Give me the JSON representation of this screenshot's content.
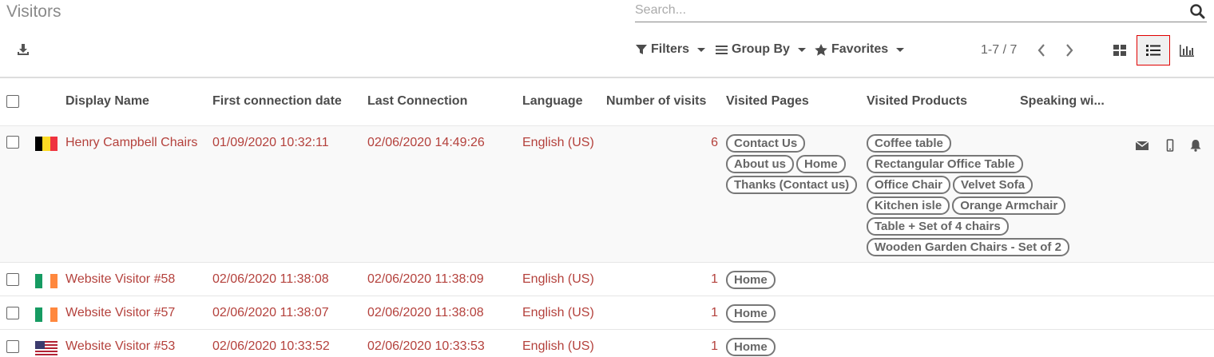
{
  "page": {
    "title": "Visitors"
  },
  "search": {
    "placeholder": "Search..."
  },
  "toolbar": {
    "filters": "Filters",
    "group_by": "Group By",
    "favorites": "Favorites",
    "pager": "1-7 / 7"
  },
  "columns": {
    "display_name": "Display Name",
    "first_connection": "First connection date",
    "last_connection": "Last Connection",
    "language": "Language",
    "visits": "Number of visits",
    "pages": "Visited Pages",
    "products": "Visited Products",
    "speaking": "Speaking wi..."
  },
  "rows": [
    {
      "name": "Henry Campbell Chairs",
      "flag": "belgium",
      "flag_colors": [
        "#000000",
        "#fdda24",
        "#ef3340"
      ],
      "first": "01/09/2020 10:32:11",
      "last": "02/06/2020 14:49:26",
      "language": "English (US)",
      "visits": "6",
      "pages": [
        "Contact Us",
        "About us",
        "Home",
        "Thanks (Contact us)"
      ],
      "products": [
        "Coffee table",
        "Rectangular Office Table",
        "Office Chair",
        "Velvet Sofa",
        "Kitchen isle",
        "Orange Armchair",
        "Table + Set of 4 chairs",
        "Wooden Garden Chairs - Set of 2"
      ]
    },
    {
      "name": "Website Visitor #58",
      "flag": "ireland",
      "flag_colors": [
        "#169b62",
        "#ffffff",
        "#ff883e"
      ],
      "first": "02/06/2020 11:38:08",
      "last": "02/06/2020 11:38:09",
      "language": "English (US)",
      "visits": "1",
      "pages": [
        "Home"
      ],
      "products": []
    },
    {
      "name": "Website Visitor #57",
      "flag": "ireland",
      "flag_colors": [
        "#169b62",
        "#ffffff",
        "#ff883e"
      ],
      "first": "02/06/2020 11:38:07",
      "last": "02/06/2020 11:38:08",
      "language": "English (US)",
      "visits": "1",
      "pages": [
        "Home"
      ],
      "products": []
    },
    {
      "name": "Website Visitor #53",
      "flag": "usa",
      "flag_colors": [
        "#b22234",
        "#ffffff",
        "#3c3b6e"
      ],
      "first": "02/06/2020 10:33:52",
      "last": "02/06/2020 10:33:53",
      "language": "English (US)",
      "visits": "1",
      "pages": [
        "Home"
      ],
      "products": []
    }
  ],
  "icons": {
    "search": "search-icon",
    "download": "download-icon",
    "filter": "filter-icon",
    "group_by": "list-lines-icon",
    "favorites": "star-icon",
    "prev": "chevron-left-icon",
    "next": "chevron-right-icon",
    "kanban": "kanban-icon",
    "list": "list-view-icon",
    "graph": "bar-chart-icon",
    "email": "envelope-icon",
    "sms": "mobile-icon",
    "push": "bell-icon"
  }
}
